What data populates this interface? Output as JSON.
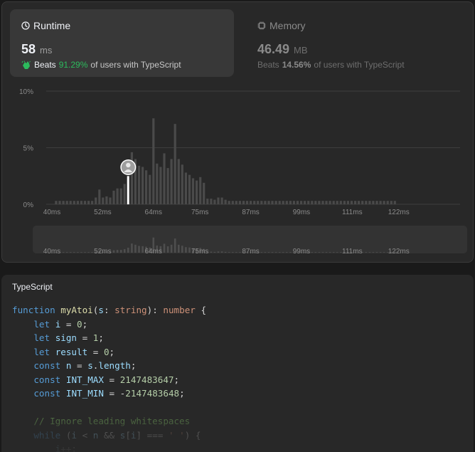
{
  "runtime": {
    "title": "Runtime",
    "value": "58",
    "unit": "ms",
    "beats_label": "Beats",
    "beats_pct": "91.29%",
    "suffix": "of users with TypeScript"
  },
  "memory": {
    "title": "Memory",
    "value": "46.49",
    "unit": "MB",
    "beats_label": "Beats",
    "beats_pct": "14.56%",
    "suffix": "of users with TypeScript"
  },
  "colors": {
    "accent_green": "#2cbb5d",
    "bar": "#4a4a4a",
    "highlight": "#ffffff"
  },
  "chart_data": {
    "type": "bar",
    "title": "",
    "xlabel": "",
    "ylabel": "",
    "yticks": [
      "10%",
      "5%",
      "0%"
    ],
    "ylim": [
      0,
      10
    ],
    "xticks": [
      "40ms",
      "52ms",
      "64ms",
      "75ms",
      "87ms",
      "99ms",
      "111ms",
      "122ms"
    ],
    "xtick_values": [
      40,
      52,
      64,
      75,
      87,
      99,
      111,
      122
    ],
    "x_start": 41,
    "x_step": 0.852,
    "values": [
      0.3,
      0.3,
      0.3,
      0.3,
      0.3,
      0.3,
      0.3,
      0.3,
      0.3,
      0.3,
      0.3,
      0.6,
      1.3,
      0.6,
      0.7,
      0.6,
      1.2,
      1.4,
      1.4,
      1.8,
      2.5,
      4.6,
      4.0,
      3.4,
      3.3,
      3.0,
      2.6,
      7.6,
      3.6,
      3.3,
      4.5,
      3.2,
      4.0,
      7.1,
      4.0,
      3.5,
      2.8,
      2.6,
      2.3,
      2.1,
      2.4,
      1.9,
      0.5,
      0.5,
      0.4,
      0.6,
      0.6,
      0.4,
      0.3,
      0.3,
      0.3,
      0.3,
      0.3,
      0.3,
      0.3,
      0.3,
      0.3,
      0.3,
      0.3,
      0.3,
      0.3,
      0.3,
      0.3,
      0.3,
      0.3,
      0.3,
      0.3,
      0.3,
      0.3,
      0.3,
      0.3,
      0.3,
      0.3,
      0.3,
      0.3,
      0.3,
      0.3,
      0.3,
      0.3,
      0.3,
      0.3,
      0.3,
      0.3,
      0.3,
      0.3,
      0.3,
      0.3,
      0.3,
      0.3,
      0.3,
      0.3,
      0.3,
      0.3,
      0.3,
      0.3
    ],
    "highlight_index": 20,
    "grid": true
  },
  "code": {
    "language": "TypeScript",
    "lines": [
      [
        [
          "kw",
          "function"
        ],
        [
          "pl",
          " "
        ],
        [
          "fn",
          "myAtoi"
        ],
        [
          "pl",
          "("
        ],
        [
          "var",
          "s"
        ],
        [
          "pl",
          ": "
        ],
        [
          "ty",
          "string"
        ],
        [
          "pl",
          "): "
        ],
        [
          "ty",
          "number"
        ],
        [
          "pl",
          " {"
        ]
      ],
      [
        [
          "pl",
          "    "
        ],
        [
          "kw",
          "let"
        ],
        [
          "pl",
          " "
        ],
        [
          "var",
          "i"
        ],
        [
          "pl",
          " = "
        ],
        [
          "nm",
          "0"
        ],
        [
          "pl",
          ";"
        ]
      ],
      [
        [
          "pl",
          "    "
        ],
        [
          "kw",
          "let"
        ],
        [
          "pl",
          " "
        ],
        [
          "var",
          "sign"
        ],
        [
          "pl",
          " = "
        ],
        [
          "nm",
          "1"
        ],
        [
          "pl",
          ";"
        ]
      ],
      [
        [
          "pl",
          "    "
        ],
        [
          "kw",
          "let"
        ],
        [
          "pl",
          " "
        ],
        [
          "var",
          "result"
        ],
        [
          "pl",
          " = "
        ],
        [
          "nm",
          "0"
        ],
        [
          "pl",
          ";"
        ]
      ],
      [
        [
          "pl",
          "    "
        ],
        [
          "kw",
          "const"
        ],
        [
          "pl",
          " "
        ],
        [
          "var",
          "n"
        ],
        [
          "pl",
          " = "
        ],
        [
          "var",
          "s"
        ],
        [
          "pl",
          "."
        ],
        [
          "var",
          "length"
        ],
        [
          "pl",
          ";"
        ]
      ],
      [
        [
          "pl",
          "    "
        ],
        [
          "kw",
          "const"
        ],
        [
          "pl",
          " "
        ],
        [
          "var",
          "INT_MAX"
        ],
        [
          "pl",
          " = "
        ],
        [
          "nm",
          "2147483647"
        ],
        [
          "pl",
          ";"
        ]
      ],
      [
        [
          "pl",
          "    "
        ],
        [
          "kw",
          "const"
        ],
        [
          "pl",
          " "
        ],
        [
          "var",
          "INT_MIN"
        ],
        [
          "pl",
          " = -"
        ],
        [
          "nm",
          "2147483648"
        ],
        [
          "pl",
          ";"
        ]
      ],
      [
        [
          "pl",
          ""
        ]
      ],
      [
        [
          "pl",
          "    "
        ],
        [
          "cm",
          "// Ignore leading whitespaces"
        ]
      ],
      [
        [
          "pl",
          "    "
        ],
        [
          "kw",
          "while"
        ],
        [
          "pl",
          " ("
        ],
        [
          "var",
          "i"
        ],
        [
          "pl",
          " < "
        ],
        [
          "var",
          "n"
        ],
        [
          "pl",
          " && "
        ],
        [
          "var",
          "s"
        ],
        [
          "pl",
          "["
        ],
        [
          "var",
          "i"
        ],
        [
          "pl",
          "] === "
        ],
        [
          "ty",
          "' '"
        ],
        [
          "pl",
          ") {"
        ]
      ],
      [
        [
          "pl",
          "        "
        ],
        [
          "var",
          "i"
        ],
        [
          "pl",
          "++;"
        ]
      ]
    ]
  }
}
